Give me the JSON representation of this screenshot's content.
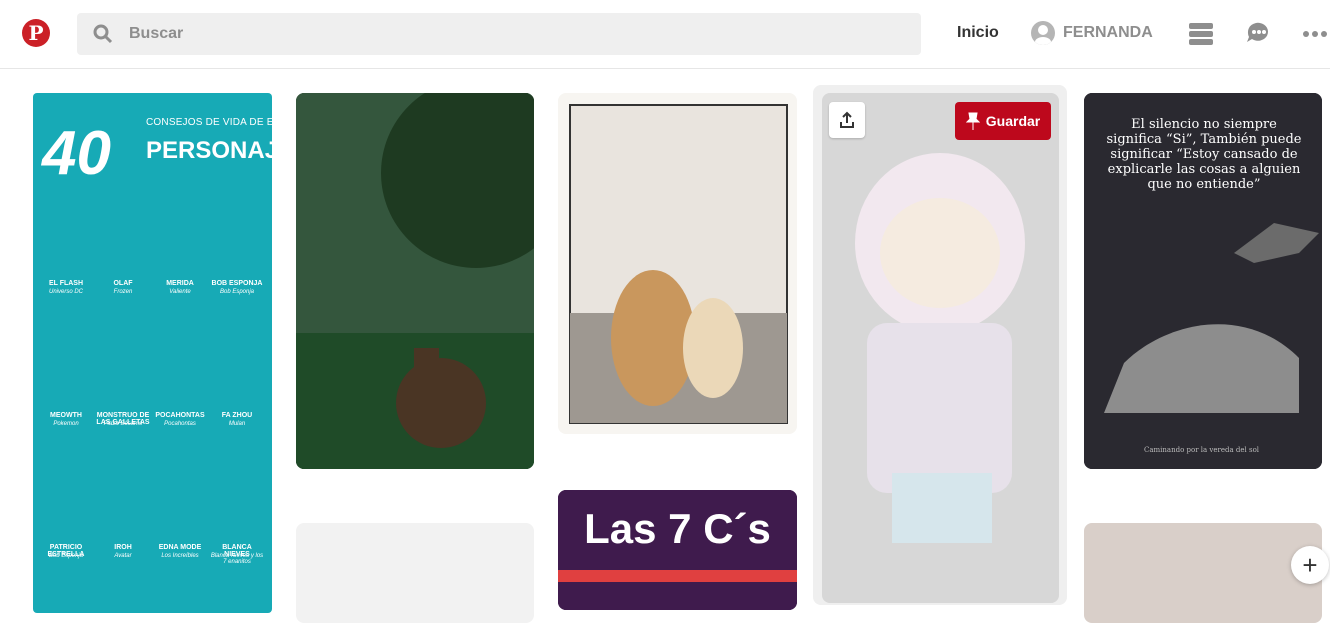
{
  "search": {
    "placeholder": "Buscar",
    "value": ""
  },
  "nav": {
    "home": "Inicio",
    "user": "FERNANDA"
  },
  "logo": "P",
  "pins": [
    {
      "top": "40",
      "subtitle": "CONSEJOS DE VIDA DE ESTOS QUERIDOS",
      "title": "PERSONAJES ANIMADOS",
      "characters": [
        {
          "name": "EL FLASH",
          "source": "Universo DC"
        },
        {
          "name": "OLAF",
          "source": "Frozen"
        },
        {
          "name": "MERIDA",
          "source": "Valiente"
        },
        {
          "name": "BOB ESPONJA",
          "source": "Bob Esponja"
        },
        {
          "name": "MEOWTH",
          "source": "Pokemon"
        },
        {
          "name": "MONSTRUO DE LAS GALLETAS",
          "source": "Plaza Sésamo"
        },
        {
          "name": "POCAHONTAS",
          "source": "Pocahontas"
        },
        {
          "name": "FA ZHOU",
          "source": "Mulan"
        },
        {
          "name": "PATRICIO ESTRELLA",
          "source": "Bob Esponja"
        },
        {
          "name": "IROH",
          "source": "Avatar"
        },
        {
          "name": "EDNA MODE",
          "source": "Los Increíbles"
        },
        {
          "name": "BLANCA NIEVES",
          "source": "Blanca Nieves y los 7 enanitos"
        }
      ]
    },
    {
      "title": "Las 7 C´s"
    },
    {
      "quote": "El silencio no siempre significa “Si”, También puede significar “Estoy cansado de explicarle las cosas a alguien que no entiende”",
      "footer": "Caminando por la vereda del sol"
    }
  ],
  "actions": {
    "save": "Guardar"
  },
  "colors": {
    "brand": "#cb2027",
    "save": "#bd081c"
  }
}
